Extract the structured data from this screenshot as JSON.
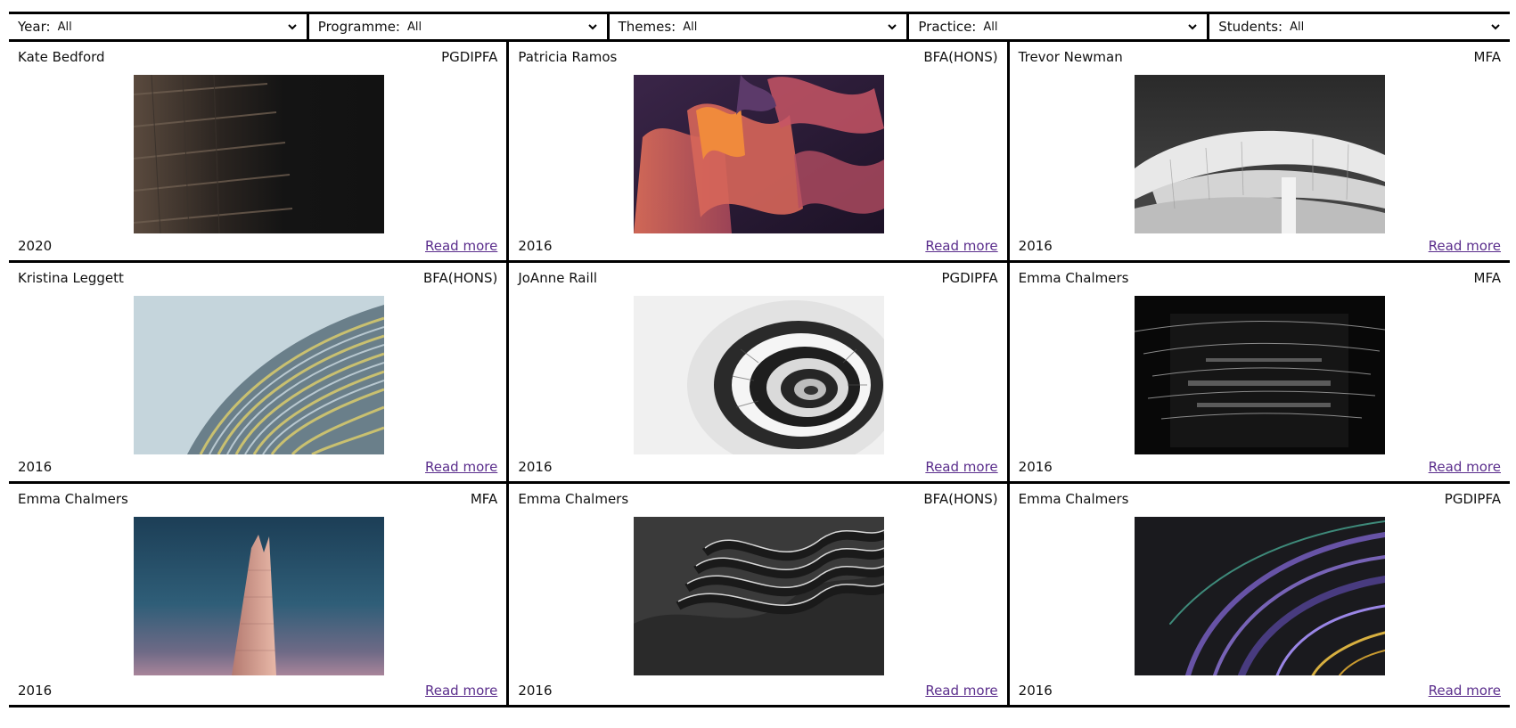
{
  "filters": [
    {
      "label": "Year:",
      "value": "All"
    },
    {
      "label": "Programme:",
      "value": "All"
    },
    {
      "label": "Themes:",
      "value": "All"
    },
    {
      "label": "Practice:",
      "value": "All"
    },
    {
      "label": "Students:",
      "value": "All"
    }
  ],
  "read_more_label": "Read more",
  "link_color": "#5a2d8c",
  "cards": [
    {
      "name": "Kate Bedford",
      "programme": "PGDIPFA",
      "year": "2020",
      "image": "dark-building-balconies"
    },
    {
      "name": "Patricia Ramos",
      "programme": "BFA(HONS)",
      "year": "2016",
      "image": "abstract-orange-ribbons"
    },
    {
      "name": "Trevor Newman",
      "programme": "MFA",
      "year": "2016",
      "image": "white-curved-architecture"
    },
    {
      "name": "Kristina Leggett",
      "programme": "BFA(HONS)",
      "year": "2016",
      "image": "facade-slats-sky"
    },
    {
      "name": "JoAnne Raill",
      "programme": "PGDIPFA",
      "year": "2016",
      "image": "spiral-staircase"
    },
    {
      "name": "Emma Chalmers",
      "programme": "MFA",
      "year": "2016",
      "image": "dark-light-streaks-building"
    },
    {
      "name": "Emma Chalmers",
      "programme": "MFA",
      "year": "2016",
      "image": "skyscraper-spire"
    },
    {
      "name": "Emma Chalmers",
      "programme": "BFA(HONS)",
      "year": "2016",
      "image": "dark-wavy-layers"
    },
    {
      "name": "Emma Chalmers",
      "programme": "PGDIPFA",
      "year": "2016",
      "image": "purple-light-trails"
    }
  ]
}
